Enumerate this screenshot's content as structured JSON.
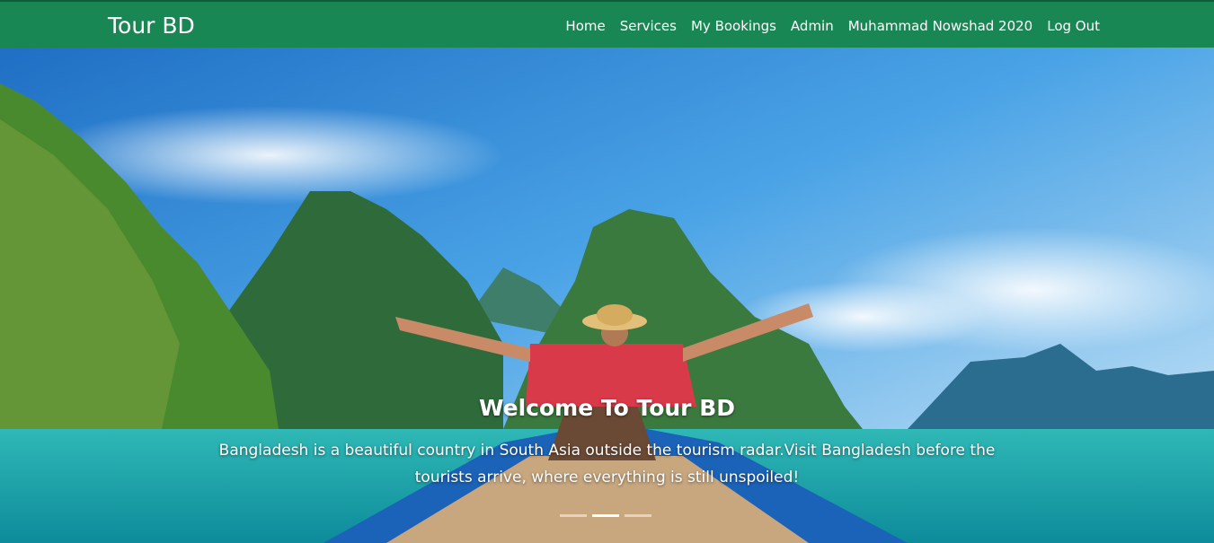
{
  "navbar": {
    "brand": "Tour BD",
    "links": [
      "Home",
      "Services",
      "My Bookings",
      "Admin",
      "Muhammad Nowshad 2020",
      "Log Out"
    ]
  },
  "hero": {
    "title": "Welcome To Tour BD",
    "description": "Bangladesh is a beautiful country in South Asia outside the tourism radar.Visit Bangladesh before the tourists arrive, where everything is still unspoiled!",
    "active_slide": 2,
    "slide_count": 3
  },
  "colors": {
    "navbar": "#198754",
    "sky": "#2f8ad8",
    "water": "#16a8a8"
  }
}
